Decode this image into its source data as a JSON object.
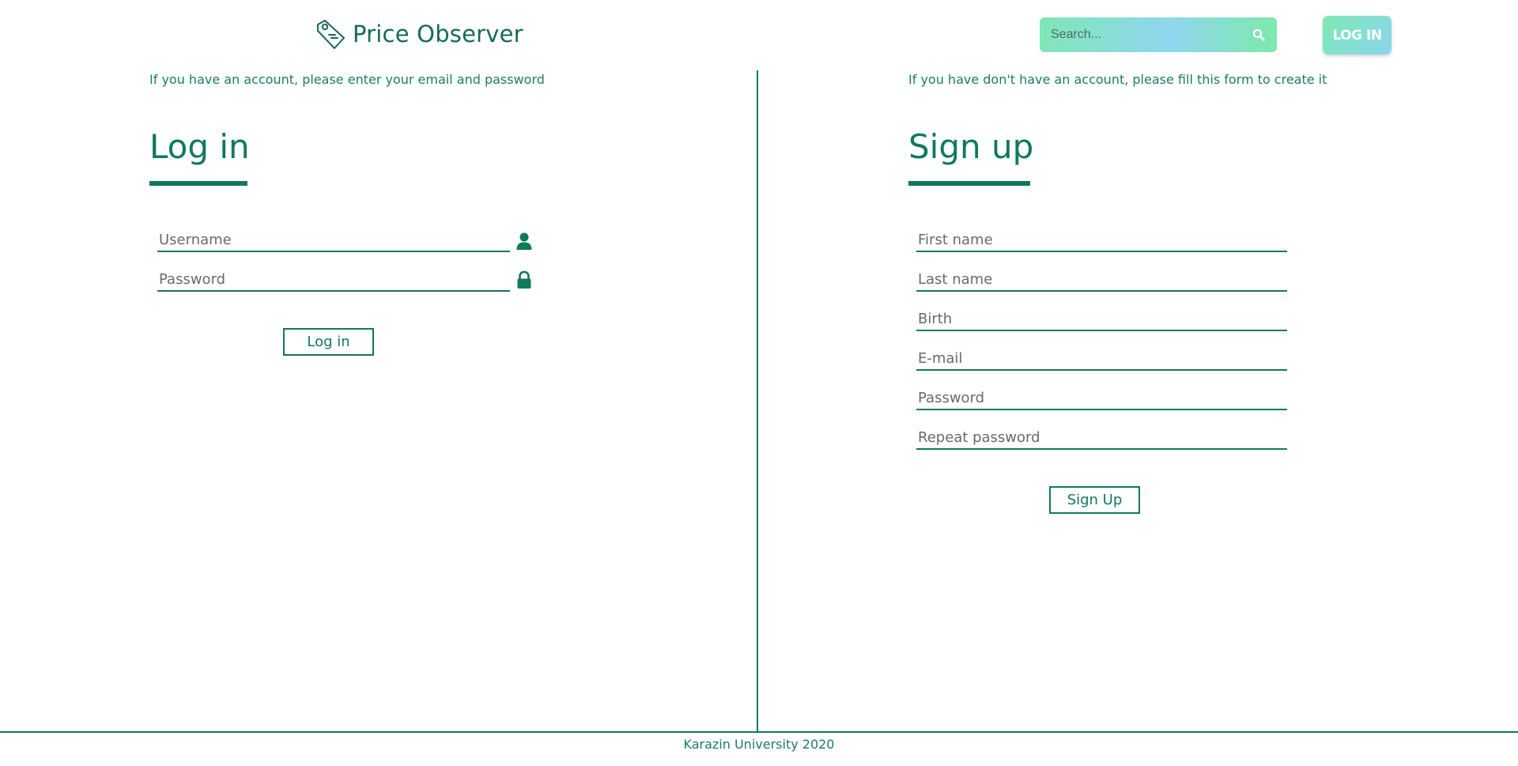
{
  "header": {
    "brand": "Price Observer",
    "logo_icon": "price-tag-icon",
    "search_placeholder": "Search...",
    "search_icon": "search-icon",
    "login_button": "LOG IN"
  },
  "login": {
    "hint": "If you have an account, please enter your email and password",
    "title": "Log in",
    "username_placeholder": "Username",
    "username_icon": "user-icon",
    "password_placeholder": "Password",
    "password_icon": "lock-icon",
    "submit_label": "Log in"
  },
  "signup": {
    "hint": "If you have don't have an account, please fill this form to create it",
    "title": "Sign up",
    "fields": [
      "First name",
      "Last name",
      "Birth",
      "E-mail",
      "Password",
      "Repeat password"
    ],
    "submit_label": "Sign Up"
  },
  "footer": {
    "text": "Karazin University 2020"
  },
  "colors": {
    "accent": "#0e7a5b",
    "gradient_start": "#7fe7b6",
    "gradient_mid": "#8fd6ef"
  }
}
